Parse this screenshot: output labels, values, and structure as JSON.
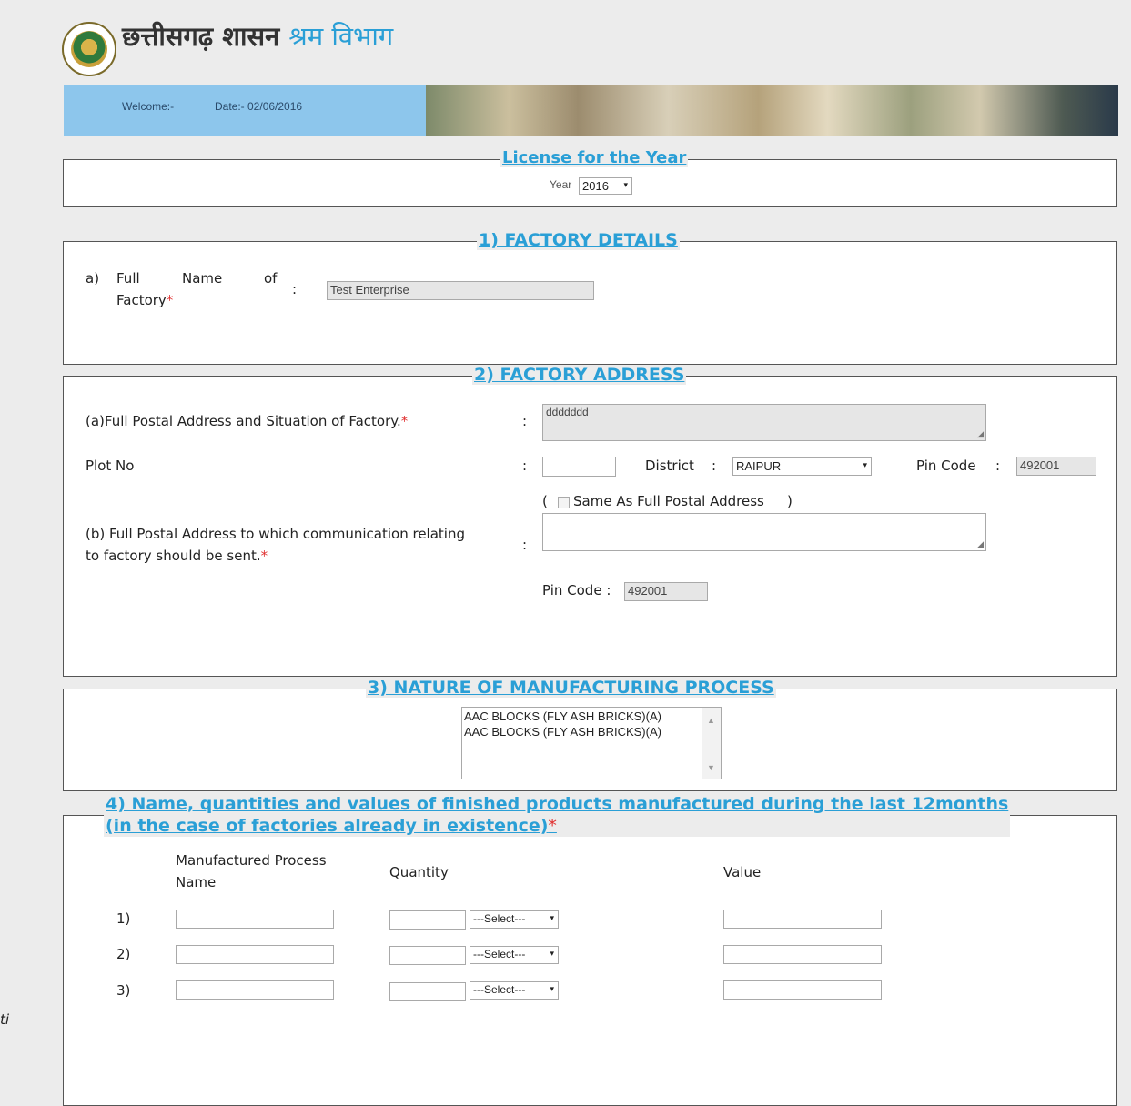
{
  "header": {
    "title_main": "छत्तीसगढ़ शासन",
    "title_dept": "श्रम विभाग"
  },
  "banner": {
    "welcome": "Welcome:-",
    "date": "Date:- 02/06/2016"
  },
  "license": {
    "legend": "License for the Year",
    "year_label": "Year",
    "year_value": "2016"
  },
  "factory_details": {
    "legend": "1) FACTORY DETAILS",
    "name_prefix": "a)",
    "name_label_1": "Full",
    "name_label_2": "Name",
    "name_label_3": "of",
    "name_label_4": "Factory",
    "colon": ":",
    "name_value": "Test Enterprise"
  },
  "factory_address": {
    "legend": "2) FACTORY ADDRESS",
    "postal_label": "(a)Full Postal Address and Situation of Factory.",
    "postal_value": "ddddddd",
    "plot_label": "Plot No",
    "plot_value": "",
    "district_label": "District",
    "district_value": "RAIPUR",
    "pin_label": "Pin Code",
    "pin_value": "492001",
    "same_as_label": "Same As Full Postal Address",
    "comm_label_1": "(b) Full Postal Address to which communication relating",
    "comm_label_2": "to factory should be sent.",
    "comm_value": "",
    "comm_pin_label": "Pin Code :",
    "comm_pin_value": "492001"
  },
  "manufacturing": {
    "legend": "3) NATURE OF MANUFACTURING PROCESS",
    "options": [
      "AAC BLOCKS (FLY ASH BRICKS)(A)",
      "AAC BLOCKS (FLY ASH BRICKS)(A)"
    ]
  },
  "products": {
    "legend_1": "4) Name, quantities and values of finished products manufactured during the last 12months",
    "legend_2": "(in the case of factories already in existence)",
    "col_name_1": "Manufactured Process",
    "col_name_2": "Name",
    "col_qty": "Quantity",
    "col_value": "Value",
    "rows": [
      {
        "num": "1)",
        "unit": "---Select---"
      },
      {
        "num": "2)",
        "unit": "---Select---"
      },
      {
        "num": "3)",
        "unit": "---Select---"
      }
    ]
  },
  "side_fragment": "ti",
  "required_mark": "*",
  "colon": ":"
}
